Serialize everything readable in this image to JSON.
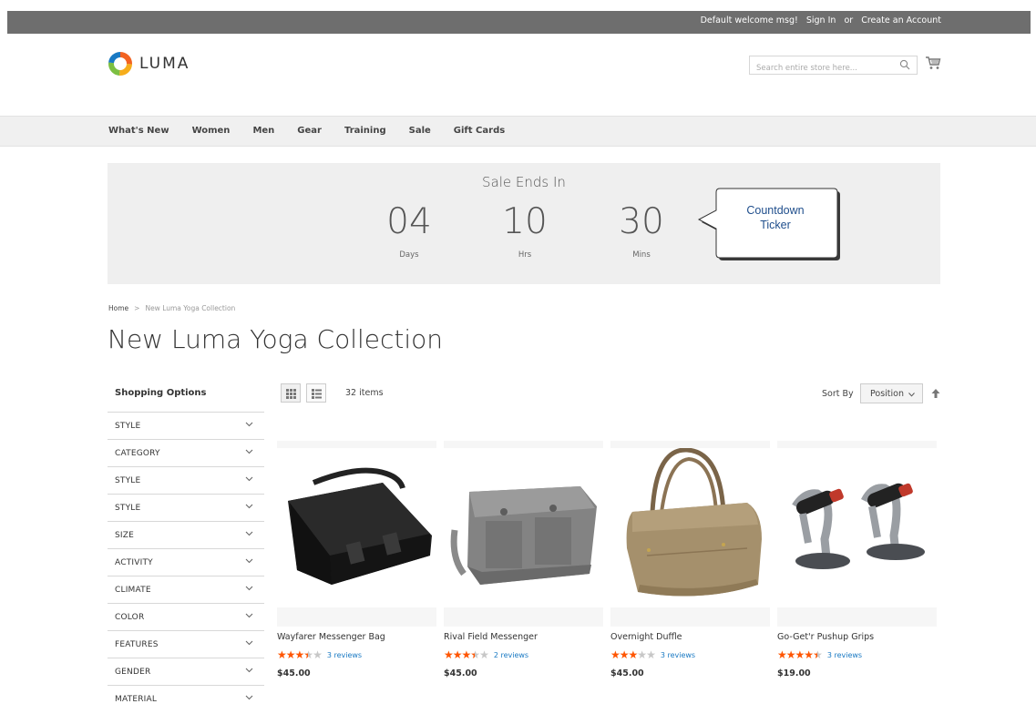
{
  "header": {
    "welcome": "Default welcome msg!",
    "sign_in": "Sign In",
    "or": "or",
    "create_account": "Create an Account",
    "logo_text": "LUMA",
    "search_placeholder": "Search entire store here..."
  },
  "nav": {
    "items": [
      "What's New",
      "Women",
      "Men",
      "Gear",
      "Training",
      "Sale",
      "Gift Cards"
    ]
  },
  "countdown": {
    "heading": "Sale Ends In",
    "days": "04",
    "days_label": "Days",
    "hours": "10",
    "hours_label": "Hrs",
    "mins": "30",
    "mins_label": "Mins",
    "callout_line1": "Countdown",
    "callout_line2": "Ticker"
  },
  "breadcrumb": {
    "home": "Home",
    "sep": ">",
    "current": "New Luma Yoga Collection"
  },
  "page_title": "New Luma Yoga Collection",
  "sidebar": {
    "title": "Shopping Options",
    "filters": [
      "STYLE",
      "CATEGORY",
      "STYLE",
      "STYLE",
      "SIZE",
      "ACTIVITY",
      "CLIMATE",
      "COLOR",
      "FEATURES",
      "GENDER",
      "MATERIAL"
    ]
  },
  "toolbar": {
    "count": "32 items",
    "sort_label": "Sort By",
    "sort_value": "Position"
  },
  "products": [
    {
      "name": "Wayfarer Messenger Bag",
      "rating": 3.5,
      "reviews": "3 reviews",
      "price": "$45.00",
      "image": "black-messenger-bag"
    },
    {
      "name": "Rival Field Messenger",
      "rating": 3.5,
      "reviews": "2 reviews",
      "price": "$45.00",
      "image": "gray-messenger-bag"
    },
    {
      "name": "Overnight Duffle",
      "rating": 3,
      "reviews": "3 reviews",
      "price": "$45.00",
      "image": "tan-duffle-bag"
    },
    {
      "name": "Go-Get'r Pushup Grips",
      "rating": 4.5,
      "reviews": "3 reviews",
      "price": "$19.00",
      "image": "pushup-grips"
    }
  ],
  "colors": {
    "topbar": "#6e6e6e",
    "nav_bg": "#f0f0f0",
    "star_on": "#ff5501",
    "review_link": "#1979c3"
  }
}
